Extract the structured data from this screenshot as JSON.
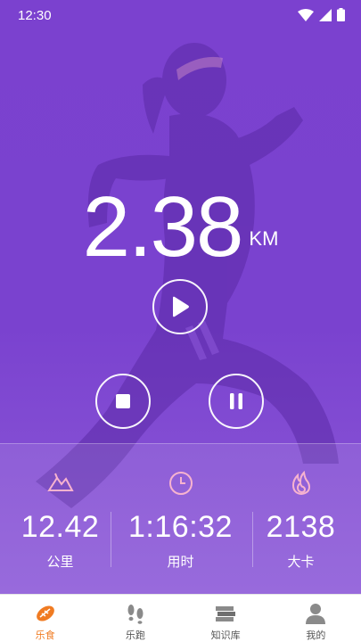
{
  "statusbar": {
    "time": "12:30"
  },
  "run": {
    "distance": "2.38",
    "unit": "KM"
  },
  "stats": [
    {
      "value": "12.42",
      "label": "公里",
      "icon": "mountain-icon"
    },
    {
      "value": "1:16:32",
      "label": "用时",
      "icon": "clock-icon"
    },
    {
      "value": "2138",
      "label": "大卡",
      "icon": "flame-icon"
    }
  ],
  "tabs": [
    {
      "label": "乐食",
      "icon": "food-icon",
      "active": true
    },
    {
      "label": "乐跑",
      "icon": "footprints-icon",
      "active": false
    },
    {
      "label": "知识库",
      "icon": "books-icon",
      "active": false
    },
    {
      "label": "我的",
      "icon": "user-icon",
      "active": false
    }
  ],
  "colors": {
    "background": "#7b41cf",
    "accent": "#f07b22",
    "text": "#ffffff"
  }
}
